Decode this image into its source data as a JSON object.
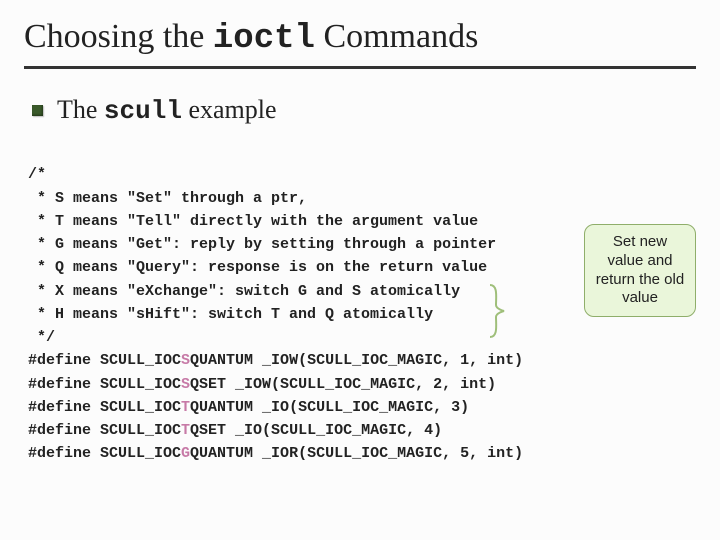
{
  "title": {
    "pre": "Choosing the ",
    "mono": "ioctl",
    "post": " Commands"
  },
  "subtitle": {
    "pre": "The ",
    "mono": "scull",
    "post": " example"
  },
  "code": {
    "c0": "/*",
    "c1": " * S means \"Set\" through a ptr,",
    "c2": " * T means \"Tell\" directly with the argument value",
    "c3": " * G means \"Get\": reply by setting through a pointer",
    "c4": " * Q means \"Query\": response is on the return value",
    "c5": " * X means \"eXchange\": switch G and S atomically",
    "c6": " * H means \"sHift\": switch T and Q atomically",
    "c7": " */",
    "d1a": "#define SCULL_IOC",
    "d1s": "S",
    "d1b": "QUANTUM _IOW(SCULL_IOC_MAGIC, 1, int)",
    "d2a": "#define SCULL_IOC",
    "d2s": "S",
    "d2b": "QSET _IOW(SCULL_IOC_MAGIC, 2, int)",
    "d3a": "#define SCULL_IOC",
    "d3s": "T",
    "d3b": "QUANTUM _IO(SCULL_IOC_MAGIC, 3)",
    "d4a": "#define SCULL_IOC",
    "d4s": "T",
    "d4b": "QSET _IO(SCULL_IOC_MAGIC, 4)",
    "d5a": "#define SCULL_IOC",
    "d5s": "G",
    "d5b": "QUANTUM _IOR(SCULL_IOC_MAGIC, 5, int)"
  },
  "callout": "Set new value and return the old value"
}
